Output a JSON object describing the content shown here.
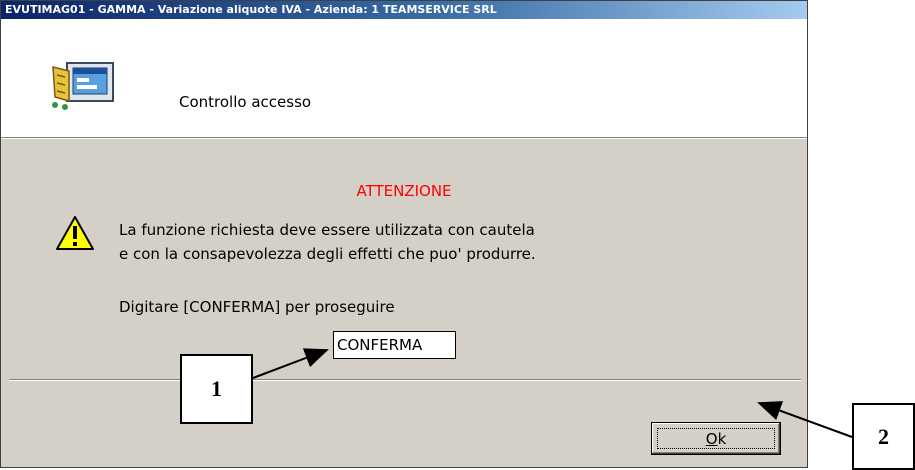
{
  "window": {
    "title": "EVUTIMAG01 - GAMMA - Variazione aliquote IVA - Azienda:   1 TEAMSERVICE SRL"
  },
  "header": {
    "title": "Controllo accesso",
    "icon": "control-panel-icon"
  },
  "message": {
    "attention": "ATTENZIONE",
    "line1": "La funzione richiesta deve essere utilizzata con cautela",
    "line2": "e con la consapevolezza degli effetti che puo' produrre.",
    "prompt": "Digitare [CONFERMA] per proseguire",
    "icon": "warning-icon"
  },
  "confirm_input": {
    "value": "CONFERMA"
  },
  "buttons": {
    "ok_mnemonic": "O",
    "ok_rest": "k"
  },
  "callouts": {
    "one": "1",
    "two": "2"
  },
  "colors": {
    "attention": "#ff0000",
    "dialog_bg": "#d4d0c8",
    "titlebar_start": "#0a246a",
    "titlebar_end": "#a6caf0"
  }
}
